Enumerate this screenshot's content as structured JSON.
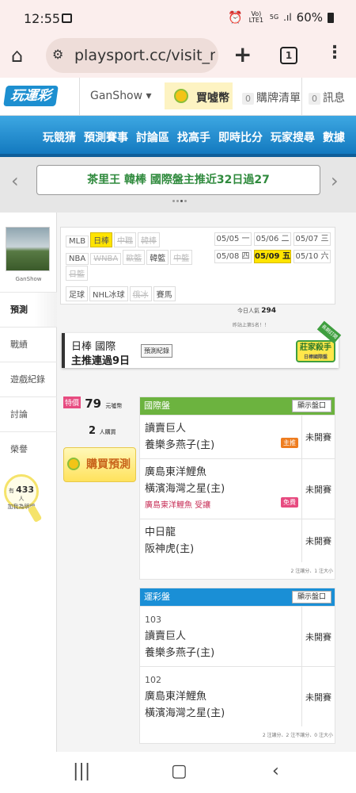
{
  "status": {
    "time": "12:55",
    "volte": "Vo) LTE1",
    "net": "5G",
    "battery": "60%"
  },
  "browser": {
    "url": "playsport.cc/visit_m",
    "tab_count": "1"
  },
  "site_header": {
    "logo": "玩運彩",
    "user": "GanShow",
    "coin_label": "買噓幣",
    "cart_count": "0",
    "cart_label": "購牌清單",
    "msg_count": "0",
    "msg_label": "訊息"
  },
  "nav": [
    "玩競猜",
    "預測賽事",
    "討論區",
    "找高手",
    "即時比分",
    "玩家搜尋",
    "數據"
  ],
  "promo": {
    "text": "茶里王 韓棒 國際盤主推近32日過27"
  },
  "sidebar": {
    "username": "GanShow",
    "items": [
      "預測",
      "戰績",
      "遊戲紀錄",
      "討論",
      "榮譽"
    ],
    "popularity_prefix": "有",
    "popularity_count": "433",
    "popularity_unit": "人",
    "popularity_suffix": "加我為明燈"
  },
  "filters": {
    "row1": [
      {
        "label": "MLB",
        "state": "normal"
      },
      {
        "label": "日棒",
        "state": "selected"
      },
      {
        "label": "中職",
        "state": "disabled"
      },
      {
        "label": "韓棒",
        "state": "disabled"
      }
    ],
    "row2": [
      {
        "label": "NBA",
        "state": "normal"
      },
      {
        "label": "WNBA",
        "state": "disabled"
      },
      {
        "label": "歐籃",
        "state": "disabled"
      },
      {
        "label": "韓籃",
        "state": "normal"
      },
      {
        "label": "中籃",
        "state": "disabled"
      }
    ],
    "row3": [
      {
        "label": "日籃",
        "state": "disabled"
      }
    ],
    "row4": [
      {
        "label": "足球",
        "state": "normal"
      },
      {
        "label": "NHL冰球",
        "state": "normal"
      },
      {
        "label": "俄冰",
        "state": "disabled"
      },
      {
        "label": "賽馬",
        "state": "normal"
      }
    ]
  },
  "dates": [
    {
      "label": "05/05 一",
      "selected": false
    },
    {
      "label": "05/06 二",
      "selected": false
    },
    {
      "label": "05/07 三",
      "selected": false
    },
    {
      "label": "05/08 四",
      "selected": false
    },
    {
      "label": "05/09 五",
      "selected": true
    },
    {
      "label": "05/10 六",
      "selected": false
    }
  ],
  "popularity": {
    "label": "今日人氣",
    "value": "294",
    "rank_text": "昨站上第5名！！"
  },
  "title": {
    "league": "日棒 國際",
    "streak": "主推連過9日",
    "record_button": "預測紀錄",
    "badge_main": "莊家殺手",
    "badge_sub": "日棒國際盤",
    "ribbon": "長期訂閱"
  },
  "purchase": {
    "special_tag": "特價",
    "price": "79",
    "price_unit": "元噓幣",
    "buyers": "2",
    "buyers_unit": "人購買",
    "buy_button": "購買預測"
  },
  "intl_table": {
    "title": "國際盤",
    "show_button": "顯示盤口",
    "color": "#6cb33f",
    "rows": [
      {
        "away": "讀賣巨人",
        "home": "養樂多燕子(主)",
        "note": "",
        "tag": "主推",
        "tag_color": "#ee7d20",
        "status": "未開賽"
      },
      {
        "away": "廣島東洋鯉魚",
        "home": "橫濱海灣之星(主)",
        "note": "廣島東洋鯉魚 受讓",
        "tag": "免費",
        "tag_color": "#e74b80",
        "status": "未開賽"
      },
      {
        "away": "中日龍",
        "home": "阪神虎(主)",
        "note": "",
        "tag": "",
        "tag_color": "",
        "status": "未開賽"
      }
    ],
    "footer": "2 注讓分、1 注大小"
  },
  "lottery_table": {
    "title": "運彩盤",
    "show_button": "顯示盤口",
    "color": "#1a8fd6",
    "rows": [
      {
        "num": "103",
        "away": "讀賣巨人",
        "home": "養樂多燕子(主)",
        "status": "未開賽"
      },
      {
        "num": "102",
        "away": "廣島東洋鯉魚",
        "home": "橫濱海灣之星(主)",
        "status": "未開賽"
      }
    ],
    "footer": "2 注讓分、2 注不讓分、0 注大小"
  }
}
